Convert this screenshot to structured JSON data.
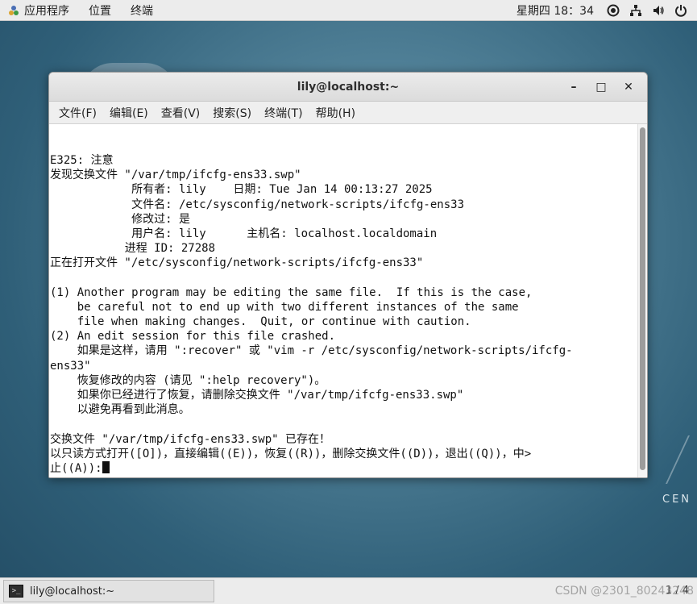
{
  "topbar": {
    "applications": "应用程序",
    "places": "位置",
    "terminal": "终端",
    "clock": "星期四 18：34"
  },
  "window": {
    "title": "lily@localhost:~",
    "minimize": "–",
    "maximize": "□",
    "close": "✕"
  },
  "menubar": {
    "file": "文件(F)",
    "edit": "编辑(E)",
    "view": "查看(V)",
    "search": "搜索(S)",
    "terminal": "终端(T)",
    "help": "帮助(H)"
  },
  "terminal": {
    "lines": [
      "E325: 注意",
      "发现交换文件 \"/var/tmp/ifcfg-ens33.swp\"",
      "            所有者: lily    日期: Tue Jan 14 00:13:27 2025",
      "            文件名: /etc/sysconfig/network-scripts/ifcfg-ens33",
      "            修改过: 是",
      "            用户名: lily      主机名: localhost.localdomain",
      "           进程 ID: 27288",
      "正在打开文件 \"/etc/sysconfig/network-scripts/ifcfg-ens33\"",
      "",
      "(1) Another program may be editing the same file.  If this is the case,",
      "    be careful not to end up with two different instances of the same",
      "    file when making changes.  Quit, or continue with caution.",
      "(2) An edit session for this file crashed.",
      "    如果是这样，请用 \":recover\" 或 \"vim -r /etc/sysconfig/network-scripts/ifcfg-",
      "ens33\"",
      "    恢复修改的内容 (请见 \":help recovery\")。",
      "    如果你已经进行了恢复，请删除交换文件 \"/var/tmp/ifcfg-ens33.swp\"",
      "    以避免再看到此消息。",
      "",
      "交换文件 \"/var/tmp/ifcfg-ens33.swp\" 已存在！",
      "以只读方式打开([O])，直接编辑((E))，恢复((R))，删除交换文件((D))，退出((Q))，中>"
    ],
    "prompt_line": "止((A)):"
  },
  "taskbar": {
    "task_label": "lily@localhost:~",
    "workspace": "1 / 4",
    "watermark": "CSDN @2301_80243248"
  },
  "desktop": {
    "logo_text": "CEN"
  },
  "icons": {
    "apps": "apps-icon",
    "accessibility": "accessibility-icon",
    "network": "network-icon",
    "volume": "volume-icon",
    "power": "power-icon"
  }
}
